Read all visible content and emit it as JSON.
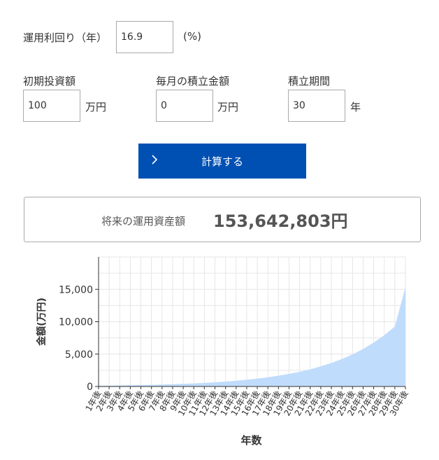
{
  "form": {
    "rate_label": "運用利回り（年）",
    "rate_value": "16.9",
    "rate_unit": "(%)",
    "initial_label": "初期投資額",
    "initial_value": "100",
    "initial_unit": "万円",
    "monthly_label": "毎月の積立金額",
    "monthly_value": "0",
    "monthly_unit": "万円",
    "period_label": "積立期間",
    "period_value": "30",
    "period_unit": "年",
    "calc_button": "計算する"
  },
  "result": {
    "label": "将来の運用資産額",
    "value": "153,642,803円"
  },
  "colors": {
    "accent": "#0050b3",
    "area_fill": "#c0dcfc"
  },
  "icons": {
    "button_icon": "chevron-right-icon"
  },
  "chart_data": {
    "type": "area",
    "xlabel": "年数",
    "ylabel": "金額(万円)",
    "ylim": [
      0,
      20000
    ],
    "yticks": [
      0,
      5000,
      10000,
      15000
    ],
    "ytick_labels": [
      "0",
      "5,000",
      "10,000",
      "15,000"
    ],
    "grid": true,
    "categories": [
      "1年後",
      "2年後",
      "3年後",
      "4年後",
      "5年後",
      "6年後",
      "7年後",
      "8年後",
      "9年後",
      "10年後",
      "11年後",
      "12年後",
      "13年後",
      "14年後",
      "15年後",
      "16年後",
      "17年後",
      "18年後",
      "19年後",
      "20年後",
      "21年後",
      "22年後",
      "23年後",
      "24年後",
      "25年後",
      "26年後",
      "27年後",
      "28年後",
      "29年後",
      "30年後"
    ],
    "values": [
      117,
      137,
      160,
      187,
      218,
      255,
      298,
      349,
      408,
      476,
      557,
      651,
      761,
      890,
      1040,
      1216,
      1422,
      1662,
      1943,
      2271,
      2655,
      3104,
      3629,
      4242,
      4959,
      5797,
      6777,
      7923,
      9262,
      15364
    ]
  }
}
